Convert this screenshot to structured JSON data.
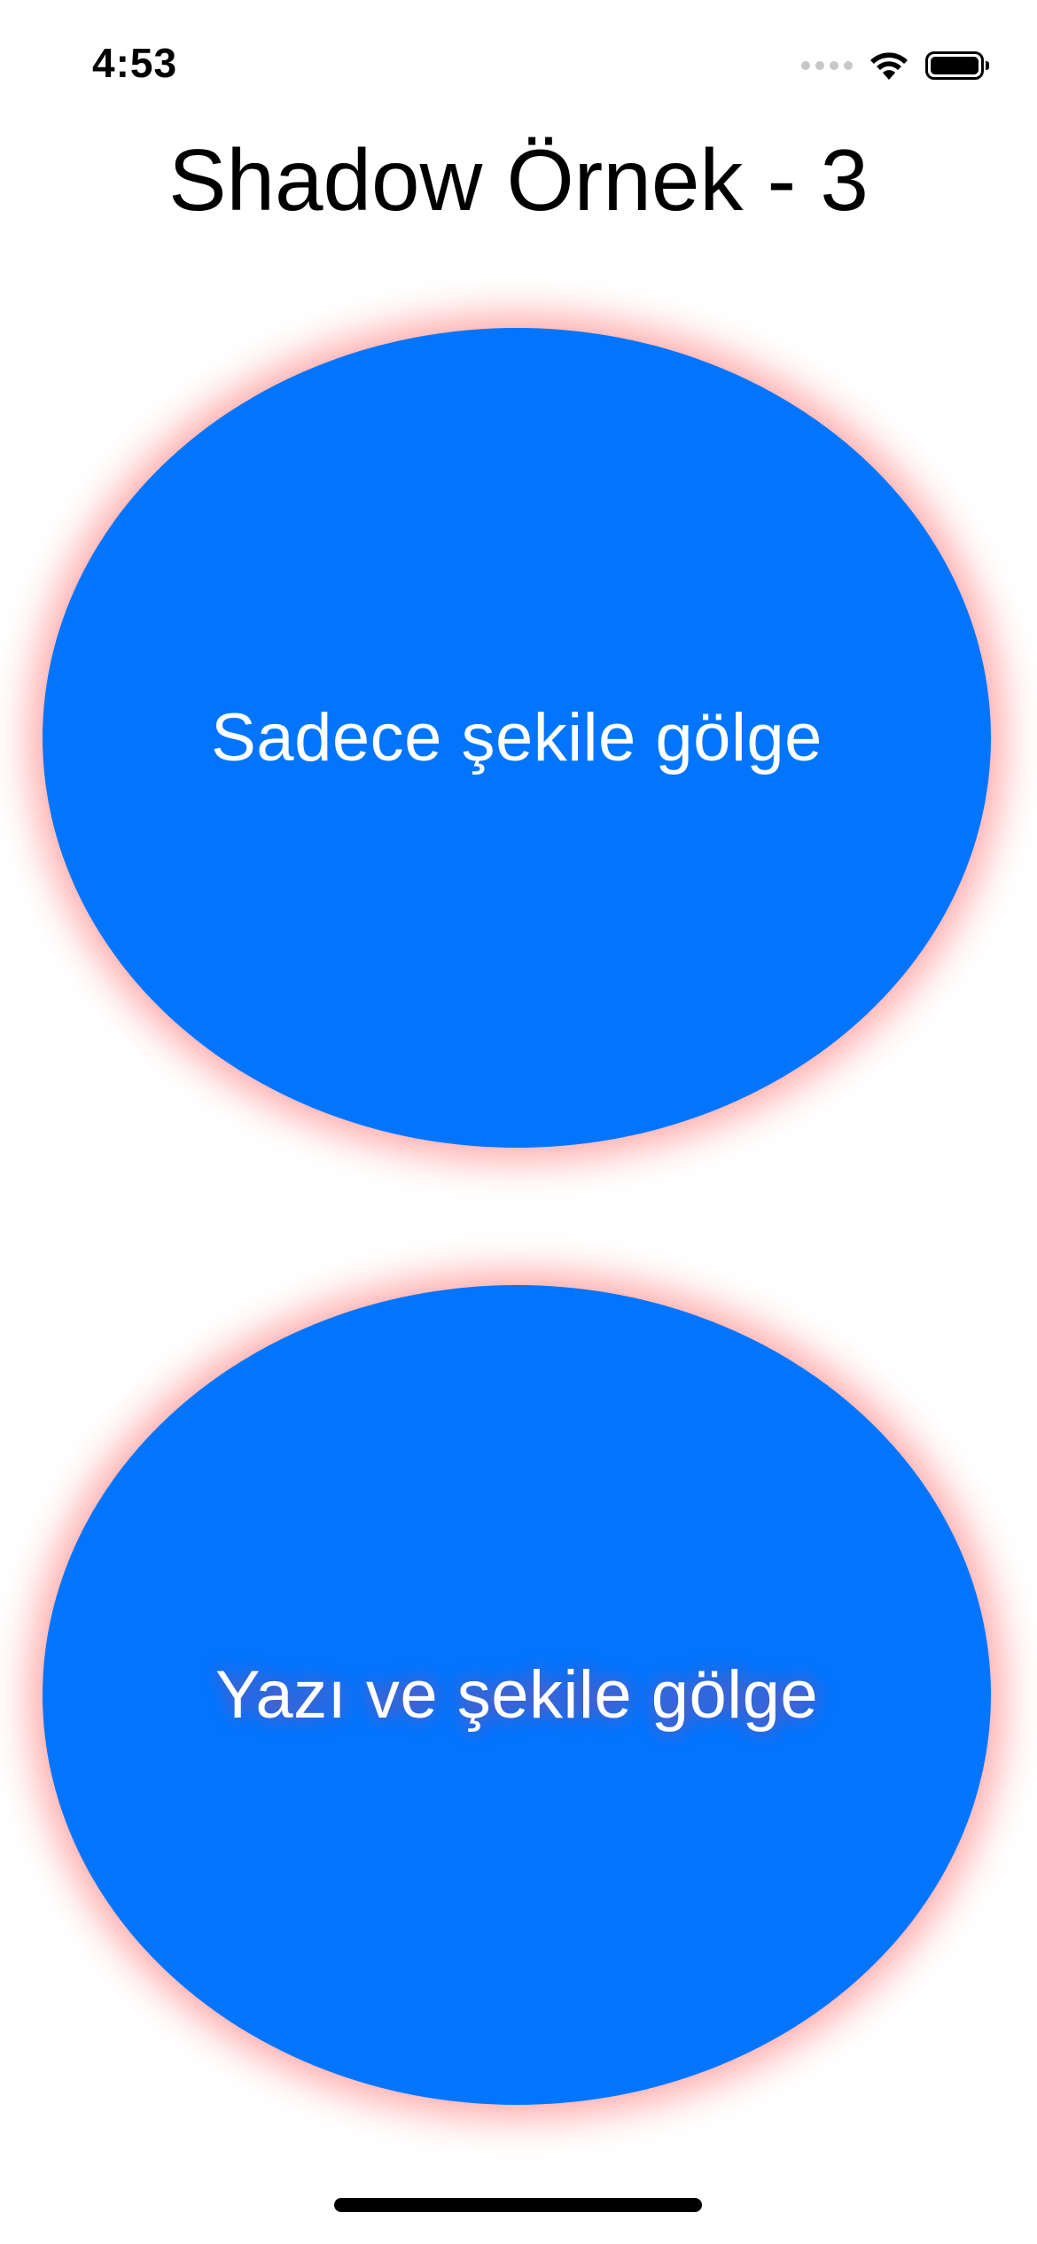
{
  "status_bar": {
    "time": "4:53",
    "icons": [
      "cellular-signal-icon",
      "wifi-icon",
      "battery-icon"
    ]
  },
  "title": "Shadow Örnek - 3",
  "buttons": [
    {
      "label": "Sadece şekile gölge",
      "label_shadow": false
    },
    {
      "label": "Yazı ve şekile gölge",
      "label_shadow": true
    }
  ],
  "colors": {
    "button_fill": "#0275fe",
    "shape_shadow": "#ff5f5f",
    "label_text": "#ffffff",
    "background": "#ffffff"
  }
}
